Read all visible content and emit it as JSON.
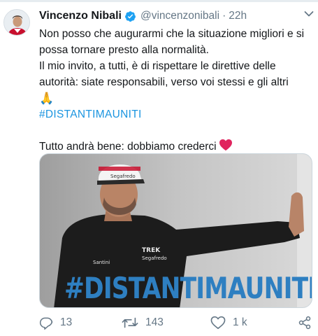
{
  "tweet": {
    "author_name": "Vincenzo Nibali",
    "handle": "@vincenzonibali",
    "separator": "·",
    "time": "22h",
    "text_lines": [
      "Non posso che augurarmi che la situazione migliori e si possa tornare presto alla normalità.",
      "Il mio invito, a tutti, è di rispettare le direttive delle autorità: siate responsabili, verso voi stessi e gli altri"
    ],
    "emoji": "🙏",
    "hashtag": "#DISTANTIMAUNITI",
    "closing_line": "Tutto andrà bene: dobbiamo crederci",
    "media": {
      "caption": "#DISTANTIMAUNITI",
      "cap_text": "Segafredo",
      "jersey_brand": "TREK",
      "jersey_sponsor": "Segafredo",
      "sleeve_brand": "Santini"
    },
    "actions": {
      "replies": "13",
      "retweets": "143",
      "likes": "1 k"
    }
  },
  "colors": {
    "link": "#1b95e0",
    "verified": "#1da1f2",
    "secondary_text": "#657786",
    "heart": "#e0245e",
    "caption": "#2e7fc1"
  },
  "icons": {
    "verified": "verified-badge-icon",
    "more": "chevron-down-icon",
    "reply": "reply-icon",
    "retweet": "retweet-icon",
    "like": "heart-icon",
    "share": "share-icon",
    "emoji_heart": "red-heart-icon"
  }
}
